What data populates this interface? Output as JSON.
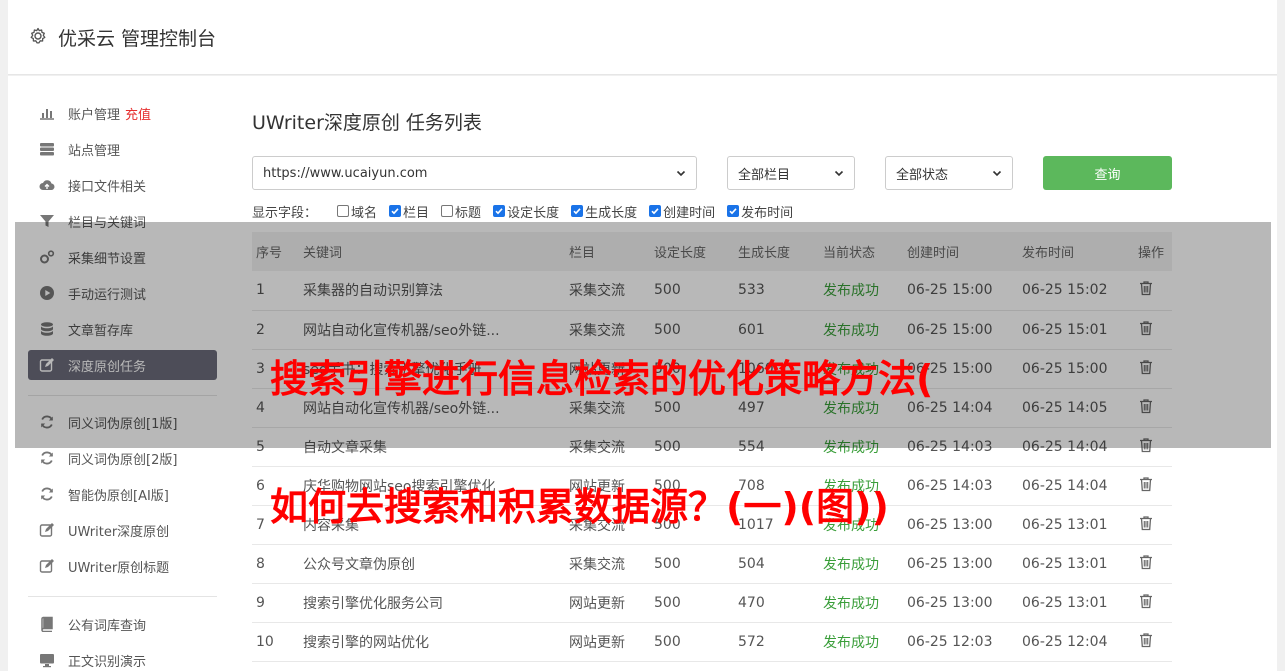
{
  "app": {
    "title": "优采云 管理控制台"
  },
  "sidebar": {
    "items": [
      {
        "label": "账户管理",
        "tag": "充值",
        "icon": "bar-chart-icon"
      },
      {
        "label": "站点管理",
        "icon": "server-icon"
      },
      {
        "label": "接口文件相关",
        "icon": "cloud-upload-icon"
      },
      {
        "label": "栏目与关键词",
        "icon": "filter-icon"
      },
      {
        "label": "采集细节设置",
        "icon": "gears-icon"
      },
      {
        "label": "手动运行测试",
        "icon": "play-circle-icon"
      },
      {
        "label": "文章暂存库",
        "icon": "database-icon"
      },
      {
        "label": "深度原创任务",
        "icon": "edit-icon",
        "active": true
      },
      {
        "label": "同义词伪原创[1版]",
        "icon": "refresh-icon"
      },
      {
        "label": "同义词伪原创[2版]",
        "icon": "refresh-icon"
      },
      {
        "label": "智能伪原创[AI版]",
        "icon": "refresh-icon"
      },
      {
        "label": "UWriter深度原创",
        "icon": "edit-icon"
      },
      {
        "label": "UWriter原创标题",
        "icon": "edit-icon"
      },
      {
        "label": "公有词库查询",
        "icon": "book-icon"
      },
      {
        "label": "正文识别演示",
        "icon": "monitor-icon"
      }
    ]
  },
  "page": {
    "title": "UWriter深度原创 任务列表"
  },
  "filters": {
    "site": "https://www.ucaiyun.com",
    "column": "全部栏目",
    "status": "全部状态",
    "query_label": "查询"
  },
  "fields": {
    "label": "显示字段：",
    "options": [
      {
        "label": "域名",
        "checked": false
      },
      {
        "label": "栏目",
        "checked": true
      },
      {
        "label": "标题",
        "checked": false
      },
      {
        "label": "设定长度",
        "checked": true
      },
      {
        "label": "生成长度",
        "checked": true
      },
      {
        "label": "创建时间",
        "checked": true
      },
      {
        "label": "发布时间",
        "checked": true
      }
    ]
  },
  "table": {
    "headers": [
      "序号",
      "关键词",
      "栏目",
      "设定长度",
      "生成长度",
      "当前状态",
      "创建时间",
      "发布时间",
      "操作"
    ],
    "rows": [
      [
        "1",
        "采集器的自动识别算法",
        "采集交流",
        "500",
        "533",
        "发布成功",
        "06-25 15:00",
        "06-25 15:02"
      ],
      [
        "2",
        "网站自动化宣传机器/seo外链...",
        "采集交流",
        "500",
        "601",
        "发布成功",
        "06-25 15:00",
        "06-25 15:01"
      ],
      [
        "3",
        "seo手书：搜索引擎优化手册",
        "网站更新",
        "500",
        "1060",
        "发布成功",
        "06-25 15:00",
        "06-25 15:00"
      ],
      [
        "4",
        "网站自动化宣传机器/seo外链...",
        "采集交流",
        "500",
        "497",
        "发布成功",
        "06-25 14:04",
        "06-25 14:05"
      ],
      [
        "5",
        "自动文章采集",
        "采集交流",
        "500",
        "554",
        "发布成功",
        "06-25 14:03",
        "06-25 14:04"
      ],
      [
        "6",
        "庆华购物网站seo搜索引擎优化",
        "网站更新",
        "500",
        "708",
        "发布成功",
        "06-25 14:03",
        "06-25 14:04"
      ],
      [
        "7",
        "内容采集",
        "采集交流",
        "500",
        "1017",
        "发布成功",
        "06-25 13:00",
        "06-25 13:01"
      ],
      [
        "8",
        "公众号文章伪原创",
        "采集交流",
        "500",
        "504",
        "发布成功",
        "06-25 13:00",
        "06-25 13:01"
      ],
      [
        "9",
        "搜索引擎优化服务公司",
        "网站更新",
        "500",
        "470",
        "发布成功",
        "06-25 13:00",
        "06-25 13:01"
      ],
      [
        "10",
        "搜索引擎的网站优化",
        "网站更新",
        "500",
        "572",
        "发布成功",
        "06-25 12:03",
        "06-25 12:04"
      ]
    ]
  },
  "overlay": {
    "line1": "搜索引擎进行信息检索的优化策略方法(",
    "line2": "如何去搜索和积累数据源？(一)(图))"
  }
}
